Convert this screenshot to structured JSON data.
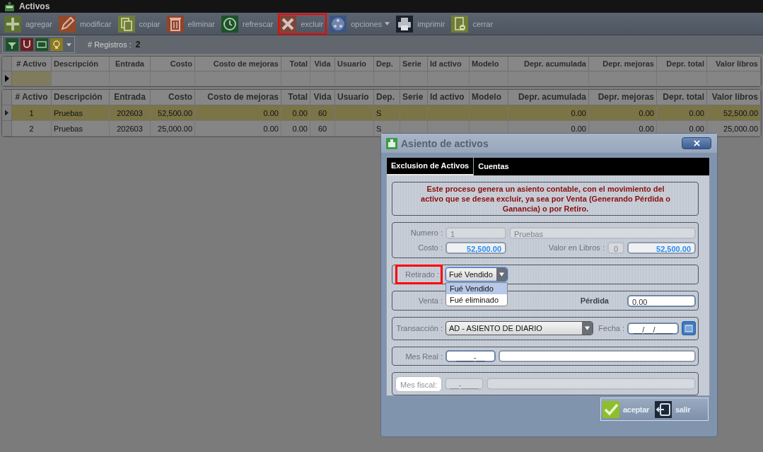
{
  "window": {
    "title": "Activos"
  },
  "toolbar": [
    {
      "label": "agregar",
      "kind": "button",
      "highlighted": false
    },
    {
      "label": "modificar",
      "kind": "button",
      "highlighted": false
    },
    {
      "label": "copiar",
      "kind": "button",
      "highlighted": false
    },
    {
      "label": "eliminar",
      "kind": "button",
      "highlighted": false
    },
    {
      "label": "refrescar",
      "kind": "button",
      "highlighted": false
    },
    {
      "label": "excluir",
      "kind": "button",
      "highlighted": true
    },
    {
      "label": "opciones",
      "kind": "menu",
      "highlighted": false
    },
    {
      "label": "imprimir",
      "kind": "button",
      "highlighted": false
    },
    {
      "label": "cerrar",
      "kind": "button",
      "highlighted": false
    }
  ],
  "records": {
    "label": "# Registros :",
    "count": "2"
  },
  "filter_grid": {
    "columns": [
      "# Activo",
      "Descripción",
      "Entrada",
      "Costo",
      "Costo de mejoras",
      "Total",
      "Vida",
      "Usuario",
      "Dep.",
      "Serie",
      "Id activo",
      "Modelo",
      "Depr. acumulada",
      "Depr. mejoras",
      "Depr. total",
      "Valor libros"
    ]
  },
  "table": {
    "columns": [
      "# Activo",
      "Descripción",
      "Entrada",
      "Costo",
      "Costo de mejoras",
      "Total",
      "Vida",
      "Usuario",
      "Dep.",
      "Serie",
      "Id activo",
      "Modelo",
      "Depr. acumulada",
      "Depr. mejoras",
      "Depr. total",
      "Valor libros"
    ],
    "rows": [
      {
        "selected": true,
        "cells": [
          "1",
          "Pruebas",
          "202603",
          "52,500.00",
          "0.00",
          "0.00",
          "60",
          "",
          "S",
          "",
          "",
          "",
          "0.00",
          "0.00",
          "0.00",
          "52,500.00"
        ]
      },
      {
        "selected": false,
        "cells": [
          "2",
          "Pruebas",
          "202603",
          "25,000.00",
          "0.00",
          "0.00",
          "60",
          "",
          "S",
          "",
          "",
          "",
          "0.00",
          "0.00",
          "0.00",
          "25,000.00"
        ]
      }
    ]
  },
  "dialog": {
    "title": "Asiento de activos",
    "tabs": [
      {
        "label": "Exclusion de Activos",
        "selected": true
      },
      {
        "label": "Cuentas",
        "selected": false
      }
    ],
    "notice": "Este proceso genera un asiento contable, con el movimiento del activo que se desea excluir, ya sea por Venta (Generando Pérdida o Ganancia)  o por Retiro.",
    "numero": {
      "label": "Numero :",
      "value": "1",
      "description": "Pruebas",
      "disabled": true
    },
    "costo": {
      "label": "Costo :",
      "value": "52,500.00"
    },
    "valor_libros": {
      "label": "Valor en Libros :",
      "count": "0",
      "value": "52,500.00"
    },
    "retirado": {
      "label": "Retirado :",
      "highlighted": true,
      "value": "Fué Vendido",
      "expanded": true,
      "options": [
        {
          "label": "Fué Vendido",
          "selected": true
        },
        {
          "label": "Fué eliminado",
          "selected": false
        }
      ]
    },
    "venta": {
      "label": "Venta :"
    },
    "perdida": {
      "label": "Pérdida",
      "value": "0.00"
    },
    "transaccion": {
      "label": "Transacción :",
      "value": "AD - ASIENTO DE DIARIO"
    },
    "fecha": {
      "label": "Fecha :",
      "value": "__/__/____"
    },
    "mes_real": {
      "label": "Mes Real :",
      "value": "____-__"
    },
    "mes_fiscal": {
      "label": "Mes fiscal:",
      "value": "__-____",
      "disabled": true
    },
    "buttons": [
      {
        "label": "aceptar",
        "kind": "accept"
      },
      {
        "label": "salir",
        "kind": "exit"
      }
    ]
  }
}
